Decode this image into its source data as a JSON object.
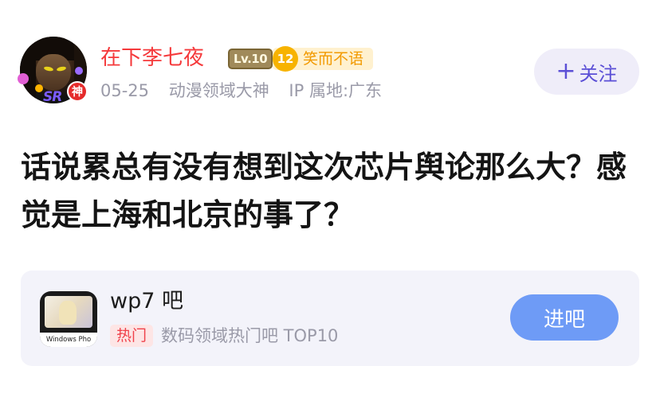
{
  "user": {
    "name": "在下李七夜",
    "level": "Lv.10",
    "god_badge": "神",
    "avatar_deco_text": "SR",
    "fan_level": "12",
    "fan_title": "笑而不语",
    "date": "05-25",
    "title": "动漫领域大神",
    "ip_location": "IP 属地:广东"
  },
  "follow_button": {
    "plus": "+",
    "label": "关注"
  },
  "post": {
    "title": "话说累总有没有想到这次芯片舆论那么大？感觉是上海和北京的事了？"
  },
  "forum": {
    "name": "wp7 吧",
    "thumb_label": "Windows Pho",
    "hot_tag": "热门",
    "description": "数码领域热门吧 TOP10",
    "enter_label": "进吧"
  },
  "colors": {
    "username": "#f5393b",
    "follow_text": "#5b4fd6",
    "enter_button": "#6e9bf6",
    "card_bg": "#f3f3fa"
  }
}
